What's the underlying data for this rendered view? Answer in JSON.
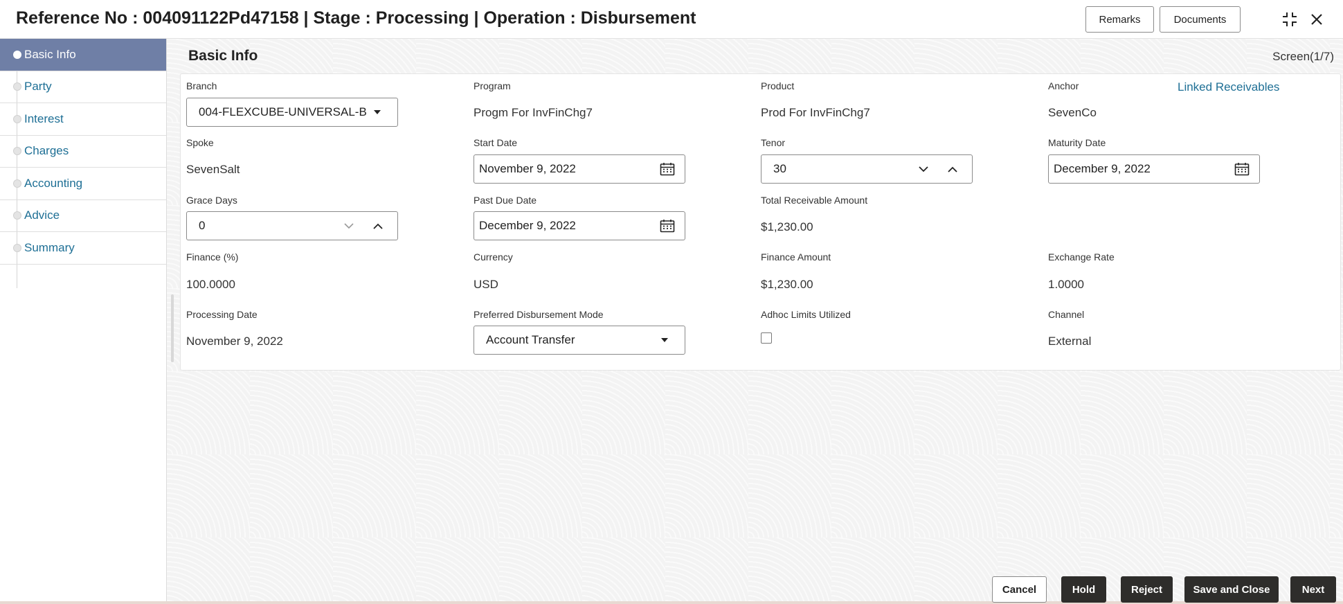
{
  "header": {
    "title": "Reference No : 004091122Pd47158 | Stage : Processing | Operation : Disbursement",
    "remarks_label": "Remarks",
    "documents_label": "Documents"
  },
  "sidebar": {
    "items": [
      {
        "label": "Basic Info",
        "active": true
      },
      {
        "label": "Party",
        "active": false
      },
      {
        "label": "Interest",
        "active": false
      },
      {
        "label": "Charges",
        "active": false
      },
      {
        "label": "Accounting",
        "active": false
      },
      {
        "label": "Advice",
        "active": false
      },
      {
        "label": "Summary",
        "active": false
      }
    ]
  },
  "main": {
    "title": "Basic Info",
    "screen_indicator": "Screen(1/7)",
    "linked_receivables": "Linked Receivables",
    "fields": {
      "branch": {
        "label": "Branch",
        "value": "004-FLEXCUBE-UNIVERSAL-B"
      },
      "program": {
        "label": "Program",
        "value": "Progm For InvFinChg7"
      },
      "product": {
        "label": "Product",
        "value": "Prod For InvFinChg7"
      },
      "anchor": {
        "label": "Anchor",
        "value": "SevenCo"
      },
      "spoke": {
        "label": "Spoke",
        "value": "SevenSalt"
      },
      "start_date": {
        "label": "Start Date",
        "value": "November 9, 2022"
      },
      "tenor": {
        "label": "Tenor",
        "value": "30"
      },
      "maturity_date": {
        "label": "Maturity Date",
        "value": "December 9, 2022"
      },
      "grace_days": {
        "label": "Grace Days",
        "value": "0"
      },
      "past_due_date": {
        "label": "Past Due Date",
        "value": "December 9, 2022"
      },
      "total_receivable_amount": {
        "label": "Total Receivable Amount",
        "value": "$1,230.00"
      },
      "finance_pct": {
        "label": "Finance (%)",
        "value": "100.0000"
      },
      "currency": {
        "label": "Currency",
        "value": "USD"
      },
      "finance_amount": {
        "label": "Finance Amount",
        "value": "$1,230.00"
      },
      "exchange_rate": {
        "label": "Exchange Rate",
        "value": "1.0000"
      },
      "processing_date": {
        "label": "Processing Date",
        "value": "November 9, 2022"
      },
      "disbursement_mode": {
        "label": "Preferred Disbursement Mode",
        "value": "Account Transfer"
      },
      "adhoc_limits": {
        "label": "Adhoc Limits Utilized",
        "checked": false
      },
      "channel": {
        "label": "Channel",
        "value": "External"
      }
    }
  },
  "footer": {
    "cancel_label": "Cancel",
    "hold_label": "Hold",
    "reject_label": "Reject",
    "save_close_label": "Save and Close",
    "next_label": "Next"
  },
  "colors": {
    "active_nav": "#6f7fa6",
    "link": "#1e6f95",
    "dark_button": "#2e2d2b"
  }
}
